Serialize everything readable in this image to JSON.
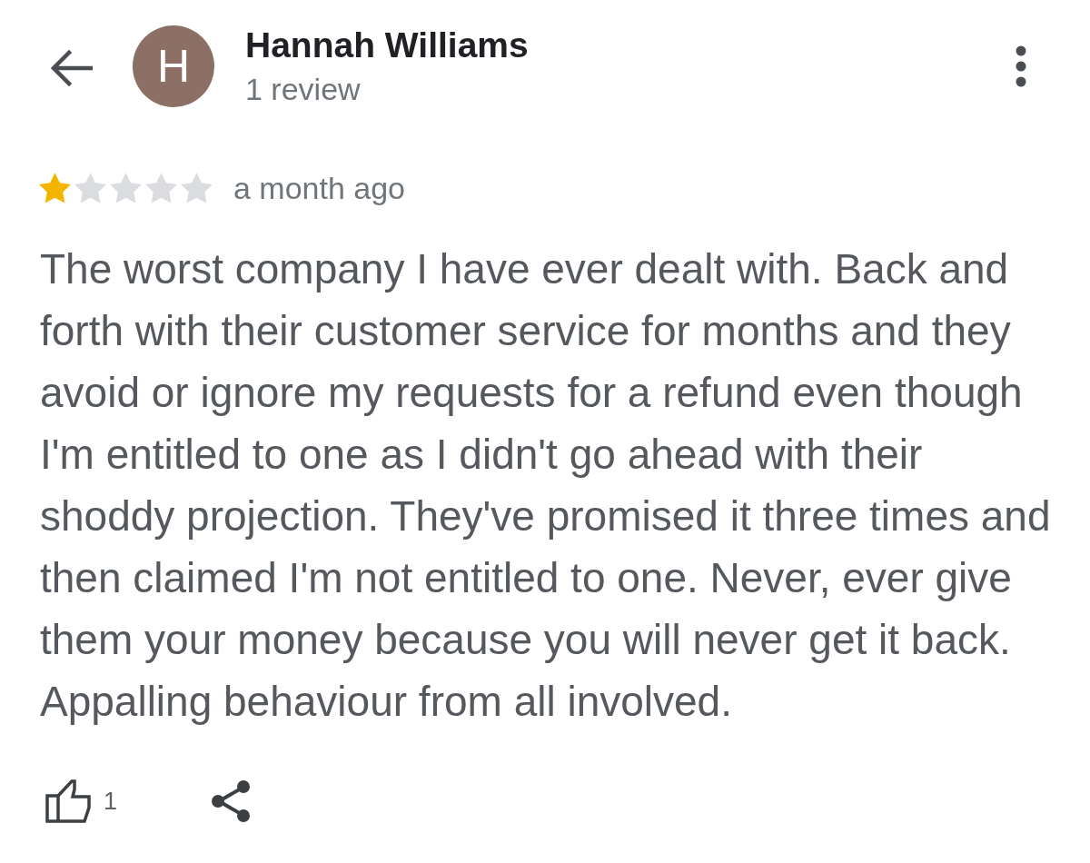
{
  "reviewer": {
    "initial": "H",
    "name": "Hannah Williams",
    "review_count": "1 review"
  },
  "review": {
    "stars": 1,
    "time": "a month ago",
    "text": "The worst company I have ever dealt with. Back and forth with their customer service for months and they avoid or ignore my requests for a refund even though I'm entitled to one as I didn't go ahead with their shoddy projection. They've promised it three times and then claimed I'm not entitled to one. Never, ever give them your money because you will never get it back. Appalling behaviour from all involved."
  },
  "actions": {
    "like_count": "1"
  }
}
